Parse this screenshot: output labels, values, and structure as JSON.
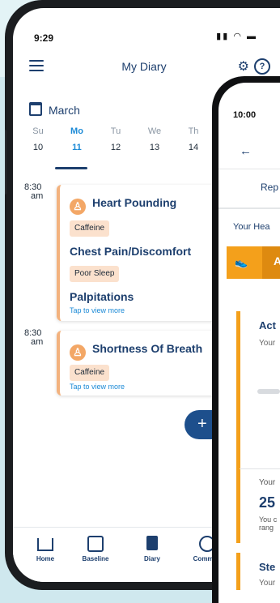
{
  "phone1": {
    "status_time": "9:29",
    "title": "My Diary",
    "month": "March",
    "week": [
      {
        "name": "Su",
        "date": "10"
      },
      {
        "name": "Mo",
        "date": "11"
      },
      {
        "name": "Tu",
        "date": "12"
      },
      {
        "name": "We",
        "date": "13"
      },
      {
        "name": "Th",
        "date": "14"
      }
    ],
    "entries": [
      {
        "time": "8:30",
        "ampm": "am",
        "symptom1": "Heart Pounding",
        "tag1": "Caffeine",
        "symptom2": "Chest Pain/Discomfort",
        "tag2": "Poor Sleep",
        "symptom3": "Palpitations",
        "tap": "Tap to view more"
      },
      {
        "time": "8:30",
        "ampm": "am",
        "symptom1": "Shortness Of Breath",
        "tag1": "Caffeine",
        "tap": "Tap to view more"
      }
    ],
    "fab_label": "+",
    "nav": [
      {
        "label": "Home"
      },
      {
        "label": "Baseline"
      },
      {
        "label": "Diary"
      },
      {
        "label": "Commun"
      }
    ]
  },
  "phone2": {
    "status_time": "10:00",
    "tab": "Rep",
    "your_heading": "Your Hea",
    "activity_letter": "A",
    "card_title": "Act",
    "card_sub": "Your",
    "card_your": "Your",
    "card_value": "25",
    "card_line1": "You c",
    "card_line2": "rang",
    "card3_title": "Ste",
    "card3_sub": "Your"
  }
}
